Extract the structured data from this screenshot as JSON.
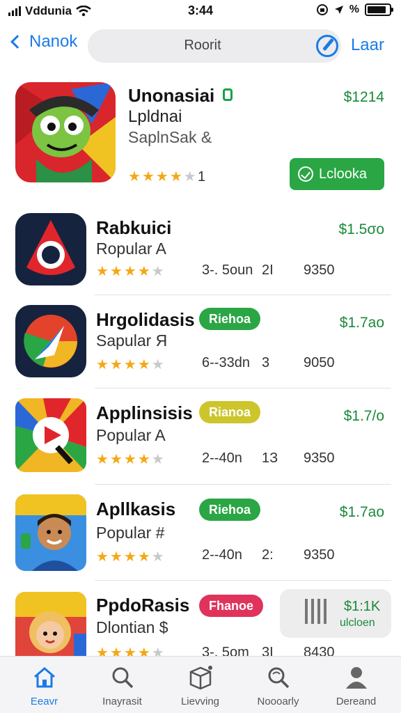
{
  "status": {
    "carrier": "Vddunia",
    "time": "3:44",
    "right_text": "%"
  },
  "nav": {
    "back_label": "Nanok",
    "search_placeholder": "Roorit",
    "right_label": "Laar"
  },
  "featured": {
    "title": "Unonasiai",
    "subtitle": "Lpldnai",
    "publisher": "SaplnSak &",
    "price": "$1214",
    "rating": 4,
    "rating_count": "1",
    "get_label": "Lclooka"
  },
  "apps": [
    {
      "title": "Rabkuici",
      "category": "Ropular A",
      "price": "$1.5σo",
      "rating": 3.5,
      "size": "3-. 5oun",
      "age": "2I",
      "downloads": "9350",
      "badge": null,
      "badge_color": null
    },
    {
      "title": "Hrgolidasis",
      "category": "Sapular Я",
      "price": "$1.7ao",
      "rating": 3.5,
      "size": "6--33dn",
      "age": "3",
      "downloads": "9050",
      "badge": "Riehoa",
      "badge_color": "#2aa644"
    },
    {
      "title": "Applinsisis",
      "category": "Popular A",
      "price": "$1.7/o",
      "rating": 3.5,
      "size": "2--40n",
      "age": "1З",
      "downloads": "9350",
      "badge": "Rianoa",
      "badge_color": "#cdc52c"
    },
    {
      "title": "Apllkasis",
      "category": "Popular #",
      "price": "$1.7ao",
      "rating": 3.5,
      "size": "2--40n",
      "age": "2:",
      "downloads": "9350",
      "badge": "Riehoa",
      "badge_color": "#2aa644"
    },
    {
      "title": "PpdoRasis",
      "category": "Dlontian $",
      "price": "$1:1K",
      "price_sub": "ulcloen",
      "rating": 3.5,
      "size": "3-. 5om",
      "age": "3I",
      "downloads": "8430",
      "badge": "Fhanoe",
      "badge_color": "#e0335c"
    }
  ],
  "tabs": [
    {
      "label": "Eeavr",
      "icon": "home-icon",
      "active": true
    },
    {
      "label": "Inayrasit",
      "icon": "search-icon",
      "active": false
    },
    {
      "label": "Lievving",
      "icon": "box-icon",
      "active": false
    },
    {
      "label": "Noooarly",
      "icon": "search-icon",
      "active": false
    },
    {
      "label": "Dereand",
      "icon": "person-icon",
      "active": false
    }
  ],
  "colors": {
    "accent": "#1a7be6",
    "price_green": "#1a8a3a",
    "star": "#f4a814",
    "get_button": "#2aa644"
  }
}
